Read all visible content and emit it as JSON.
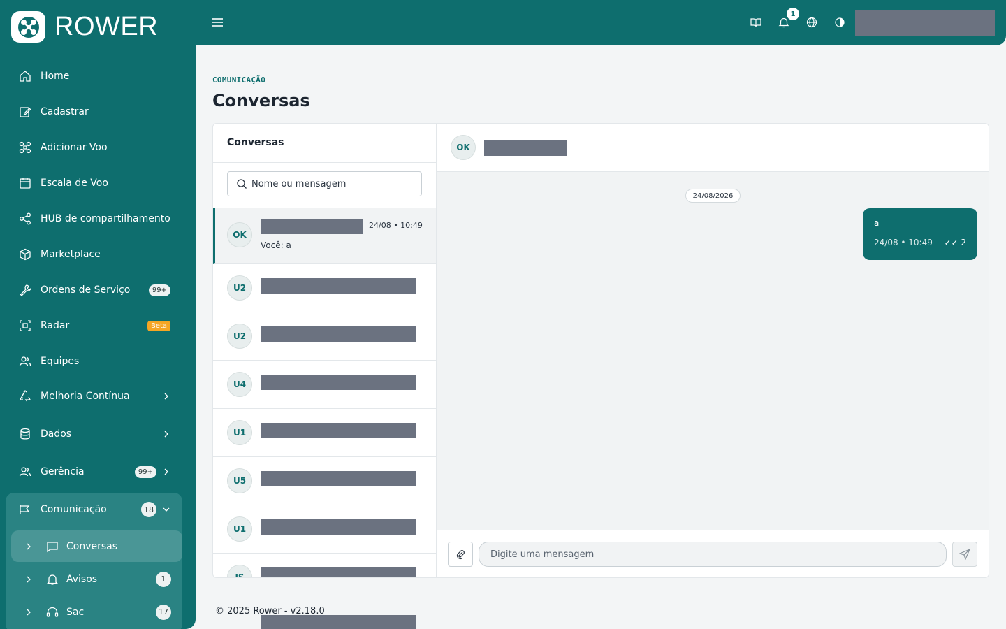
{
  "app": {
    "logo_text": "ROWER"
  },
  "sidebar": {
    "items": [
      {
        "label": "Home",
        "icon": "home-icon"
      },
      {
        "label": "Cadastrar",
        "icon": "edit-icon"
      },
      {
        "label": "Adicionar Voo",
        "icon": "drone-icon"
      },
      {
        "label": "Escala de Voo",
        "icon": "calendar-icon"
      },
      {
        "label": "HUB de compartilhamento",
        "icon": "share-icon"
      },
      {
        "label": "Marketplace",
        "icon": "box-icon"
      },
      {
        "label": "Ordens de Serviço",
        "icon": "wrench-icon",
        "badge": "99+"
      },
      {
        "label": "Radar",
        "icon": "radar-icon",
        "badge": "Beta"
      },
      {
        "label": "Equipes",
        "icon": "users-icon"
      },
      {
        "label": "Melhoria Contínua",
        "icon": "recycle-icon"
      },
      {
        "label": "Dados",
        "icon": "database-icon"
      },
      {
        "label": "Gerência",
        "icon": "users-icon",
        "badge": "99+"
      },
      {
        "label": "Comunicação",
        "icon": "megaphone-icon",
        "badge": "18"
      }
    ],
    "sub_items": [
      {
        "label": "Conversas",
        "icon": "chat-icon"
      },
      {
        "label": "Avisos",
        "icon": "bell-icon",
        "badge": "1"
      },
      {
        "label": "Sac",
        "icon": "headset-icon",
        "badge": "17"
      }
    ]
  },
  "topbar": {
    "notification_count": "1"
  },
  "header": {
    "section": "COMUNICAÇÃO",
    "title": "Conversas"
  },
  "conversations": {
    "title": "Conversas",
    "search_placeholder": "Nome ou mensagem",
    "items": [
      {
        "initials": "OK",
        "time": "24/08 • 10:49",
        "preview": "Você: a"
      },
      {
        "initials": "U2"
      },
      {
        "initials": "U2"
      },
      {
        "initials": "U4"
      },
      {
        "initials": "U1"
      },
      {
        "initials": "U5"
      },
      {
        "initials": "U1"
      },
      {
        "initials": "JS"
      }
    ]
  },
  "chat": {
    "contact_initials": "OK",
    "date_chip": "24/08/2026",
    "message": {
      "text": "a",
      "time": "24/08 • 10:49",
      "read": "✓✓ 2"
    },
    "input_placeholder": "Digite uma mensagem"
  },
  "footer": {
    "text": "© 2025 Rower - v2.18.0"
  },
  "colors": {
    "brand": "#0e6e6e",
    "beta_badge": "#f5a623",
    "redacted": "#6b7280"
  }
}
